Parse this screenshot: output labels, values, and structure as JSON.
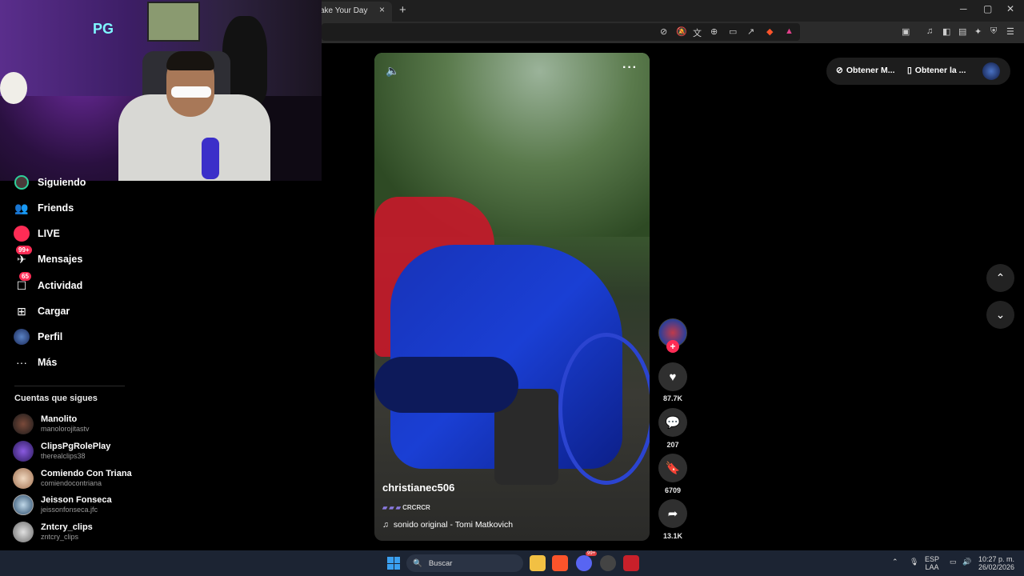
{
  "browser": {
    "active_tab_title": "ake Your Day",
    "tab_close": "×",
    "new_tab": "+",
    "window_controls": [
      "─",
      "▢",
      "✕"
    ]
  },
  "webcam": {
    "logo_text": "PG"
  },
  "sidebar": {
    "items": [
      {
        "label": "Siguiendo",
        "icon": "following-icon"
      },
      {
        "label": "Friends",
        "icon": "friends-icon"
      },
      {
        "label": "LIVE",
        "icon": "live-icon"
      },
      {
        "label": "Mensajes",
        "icon": "messages-icon",
        "badge": "99+"
      },
      {
        "label": "Actividad",
        "icon": "activity-icon",
        "badge": "65"
      },
      {
        "label": "Cargar",
        "icon": "upload-icon"
      },
      {
        "label": "Perfil",
        "icon": "profile-icon"
      },
      {
        "label": "Más",
        "icon": "more-icon"
      }
    ],
    "following_title": "Cuentas que sigues",
    "accounts": [
      {
        "name": "Manolito",
        "handle": "manolorojitastv"
      },
      {
        "name": "ClipsPgRolePlay",
        "handle": "therealclips38"
      },
      {
        "name": "Comiendo Con Triana",
        "handle": "comiendocontriana"
      },
      {
        "name": "Jeisson Fonseca",
        "handle": "jeissonfonseca.jfc"
      },
      {
        "name": "Zntcry_clips",
        "handle": "zntcry_clips"
      }
    ]
  },
  "video": {
    "author": "christianec506",
    "tags": "CRCRCR",
    "sound": "sonido original - Tomi Matkovich",
    "likes": "87.7K",
    "comments": "207",
    "saves": "6709",
    "shares": "13.1K"
  },
  "header_right": {
    "get_app_1": "Obtener M...",
    "get_app_2": "Obtener la ..."
  },
  "taskbar": {
    "search_placeholder": "Buscar",
    "lang_1": "ESP",
    "lang_2": "LAA",
    "time": "10:27 p. m.",
    "date": "26/02/2026",
    "notif_badge": "99+"
  },
  "colors": {
    "accent": "#fe2c55",
    "background": "#000000",
    "taskbar": "#1c2433"
  }
}
